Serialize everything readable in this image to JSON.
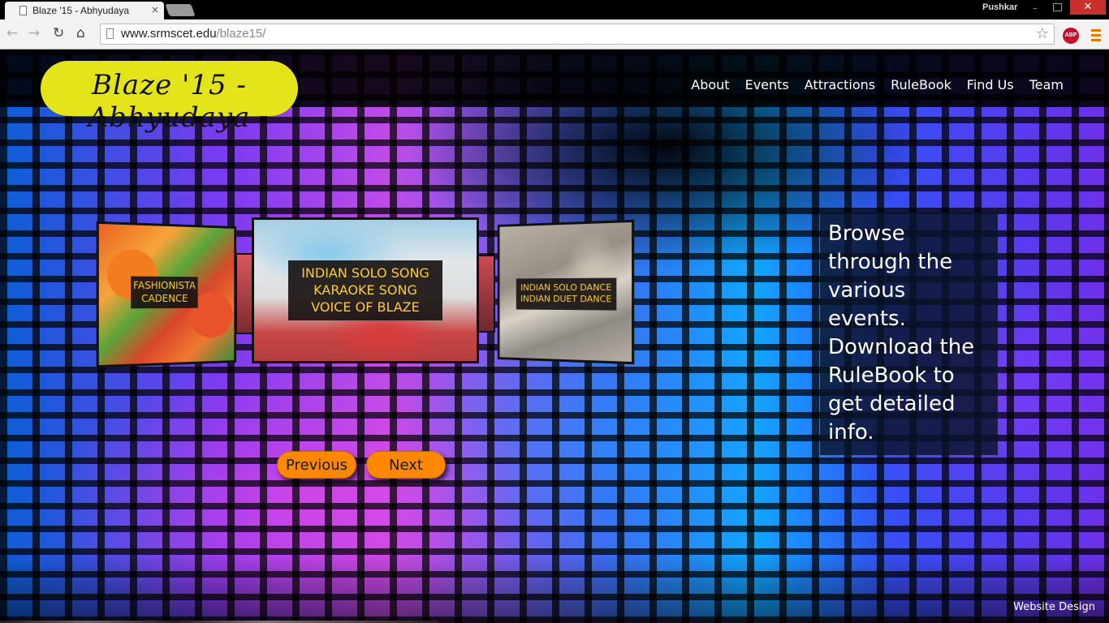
{
  "browser": {
    "tab_title": "Blaze '15 - Abhyudaya",
    "tab_close": "×",
    "profile_name": "Pushkar",
    "url_domain": "www.srmscet.edu",
    "url_path": "/blaze15/",
    "abp_label": "ABP",
    "icons": [
      "back-icon",
      "forward-icon",
      "reload-icon",
      "home-icon",
      "star-icon",
      "adblock-icon",
      "menu-icon"
    ]
  },
  "site": {
    "logo_text": "Blaze '15 - Abhyudaya",
    "logo_color": "#e4e41a",
    "nav": [
      "About",
      "Events",
      "Attractions",
      "RuleBook",
      "Find Us",
      "Team"
    ]
  },
  "carousel": {
    "cards": [
      {
        "line1": "FASHIONISTA",
        "line2": "CADENCE"
      },
      {
        "line1": "INDIAN SOLO SONG",
        "line2": "KARAOKE SONG",
        "line3": "VOICE OF BLAZE"
      },
      {
        "line1": "INDIAN SOLO DANCE",
        "line2": "INDIAN DUET DANCE"
      }
    ],
    "prev_label": "Previous",
    "next_label": "Next",
    "button_color": "#ff8800"
  },
  "info": {
    "text": "Browse through the various events. Download the RuleBook to get detailed info."
  },
  "footer": {
    "link_text": "Website Design"
  }
}
